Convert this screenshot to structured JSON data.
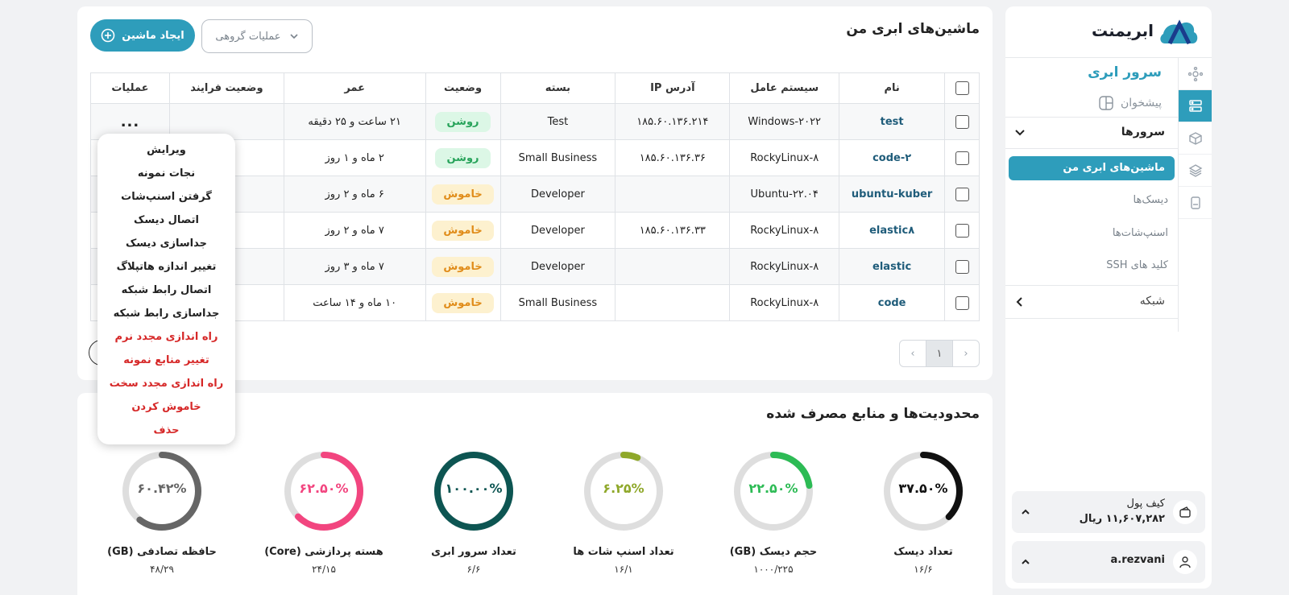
{
  "brand": {
    "name": "ابریمنت"
  },
  "sidebar": {
    "section_title": "سرور ابری",
    "dashboard_label": "پیشخوان",
    "servers_label": "سرورها",
    "items": [
      {
        "label": "ماشین‌های ابری من",
        "active": true
      },
      {
        "label": "دیسک‌ها"
      },
      {
        "label": "اسنپ‌شات‌ها"
      },
      {
        "label": "کلید های SSH"
      }
    ],
    "network_label": "شبکه",
    "wallet": {
      "label": "کیف پول",
      "value": "۱۱,۶۰۷,۲۸۲ ریال"
    },
    "user": {
      "name": "a.rezvani"
    }
  },
  "main": {
    "title": "ماشین‌های ابری من",
    "create_button": "ایجاد ماشین",
    "bulk_button": "عملیات گروهی",
    "columns": [
      "نام",
      "سیستم عامل",
      "آدرس IP",
      "بسته",
      "وضعیت",
      "عمر",
      "وضعیت فرایند",
      "عملیات"
    ],
    "rows": [
      {
        "name": "test",
        "os": "Windows-۲۰۲۲",
        "ip": "۱۸۵.۶۰.۱۳۶.۲۱۴",
        "plan": "Test",
        "status": "روشن",
        "on": true,
        "age": "۲۱ ساعت و ۲۵ دقیقه"
      },
      {
        "name": "code-۲",
        "os": "RockyLinux-۸",
        "ip": "۱۸۵.۶۰.۱۳۶.۳۶",
        "plan": "Small Business",
        "status": "روشن",
        "on": true,
        "age": "۲ ماه و ۱ روز"
      },
      {
        "name": "ubuntu-kuber",
        "os": "Ubuntu-۲۲.۰۴",
        "ip": "",
        "plan": "Developer",
        "status": "خاموش",
        "on": false,
        "age": "۶ ماه و ۲ روز"
      },
      {
        "name": "elastic۸",
        "os": "RockyLinux-۸",
        "ip": "۱۸۵.۶۰.۱۳۶.۳۳",
        "plan": "Developer",
        "status": "خاموش",
        "on": false,
        "age": "۷ ماه و ۲ روز"
      },
      {
        "name": "elastic",
        "os": "RockyLinux-۸",
        "ip": "",
        "plan": "Developer",
        "status": "خاموش",
        "on": false,
        "age": "۷ ماه و ۳ روز"
      },
      {
        "name": "code",
        "os": "RockyLinux-۸",
        "ip": "",
        "plan": "Small Business",
        "status": "خاموش",
        "on": false,
        "age": "۱۰ ماه و ۱۴ ساعت"
      }
    ],
    "ops_label": "...",
    "pagination": {
      "current": "۱"
    }
  },
  "menu": {
    "items": [
      {
        "label": "ویرایش",
        "danger": false
      },
      {
        "label": "نجات نمونه",
        "danger": false
      },
      {
        "label": "گرفتن اسنپ‌شات",
        "danger": false
      },
      {
        "label": "اتصال دیسک",
        "danger": false
      },
      {
        "label": "جداسازی دیسک",
        "danger": false
      },
      {
        "label": "تغییر اندازه هاتپلاگ",
        "danger": false
      },
      {
        "label": "اتصال رابط شبکه",
        "danger": false
      },
      {
        "label": "جداسازی رابط شبکه",
        "danger": false
      },
      {
        "label": "راه اندازی مجدد نرم",
        "danger": true
      },
      {
        "label": "تغییر منابع نمونه",
        "danger": true
      },
      {
        "label": "راه اندازی مجدد سخت",
        "danger": true
      },
      {
        "label": "خاموش کردن",
        "danger": true
      },
      {
        "label": "حذف",
        "danger": true
      }
    ]
  },
  "usage": {
    "title": "محدودیت‌ها و منابع مصرف شده",
    "gauges": [
      {
        "label": "تعداد دیسک",
        "value": "۱۶/۶",
        "percent_text": "۳۷.۵۰%",
        "fraction": 0.375,
        "color": "#111111"
      },
      {
        "label": "حجم دیسک (GB)",
        "value": "۱۰۰۰/۲۲۵",
        "percent_text": "۲۲.۵۰%",
        "fraction": 0.225,
        "color": "#2dbb55"
      },
      {
        "label": "تعداد اسنپ شات ها",
        "value": "۱۶/۱",
        "percent_text": "۶.۲۵%",
        "fraction": 0.0625,
        "color": "#8fa82a"
      },
      {
        "label": "تعداد سرور ابری",
        "value": "۶/۶",
        "percent_text": "۱۰۰.۰۰%",
        "fraction": 1.0,
        "color": "#0d5552"
      },
      {
        "label": "هسته پردازشی (Core)",
        "value": "۲۴/۱۵",
        "percent_text": "۶۲.۵۰%",
        "fraction": 0.625,
        "color": "#f2457f"
      },
      {
        "label": "حافظه تصادفی (GB)",
        "value": "۴۸/۲۹",
        "percent_text": "۶۰.۴۲%",
        "fraction": 0.6042,
        "color": "#666666"
      }
    ]
  }
}
